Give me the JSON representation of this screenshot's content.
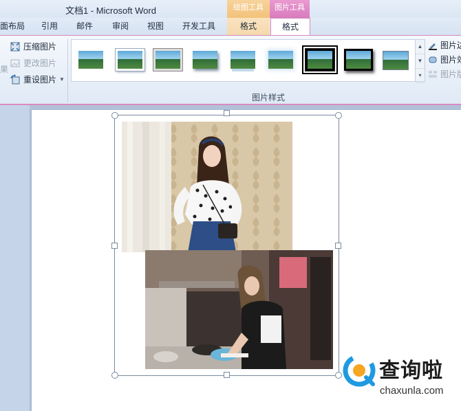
{
  "window": {
    "title": "文档1 - Microsoft Word",
    "context_drawing": "绘图工具",
    "context_picture": "图片工具"
  },
  "tabs": [
    {
      "label": "页面布局"
    },
    {
      "label": "引用"
    },
    {
      "label": "邮件"
    },
    {
      "label": "审阅"
    },
    {
      "label": "视图"
    },
    {
      "label": "开发工具"
    },
    {
      "label": "格式"
    },
    {
      "label": "格式"
    }
  ],
  "ribbon": {
    "adjust": {
      "compress": "压缩图片",
      "change": "更改图片",
      "reset": "重设图片",
      "left_glyph": "果"
    },
    "styles_group_label": "图片样式",
    "styles": [
      "simple-frame",
      "white-frame",
      "gray-frame",
      "shadow",
      "reflect",
      "reflect-soft",
      "soft-edge",
      "black-frame-selected",
      "black-frame-shadow",
      "thin-border"
    ],
    "right": {
      "border": "图片边",
      "effects": "图片效",
      "layout": "图片版"
    }
  },
  "document": {
    "images": [
      "woman-in-polka-dot-blouse-photo",
      "woman-cooking-in-kitchen-photo"
    ]
  },
  "watermark": {
    "brand_cn": "查询啦",
    "brand_en": "chaxunla.com"
  },
  "colors": {
    "accent_pink": "#d58abb",
    "accent_orange": "#f3c27a",
    "brand_blue": "#1f9ae0",
    "brand_orange": "#f5a623"
  }
}
